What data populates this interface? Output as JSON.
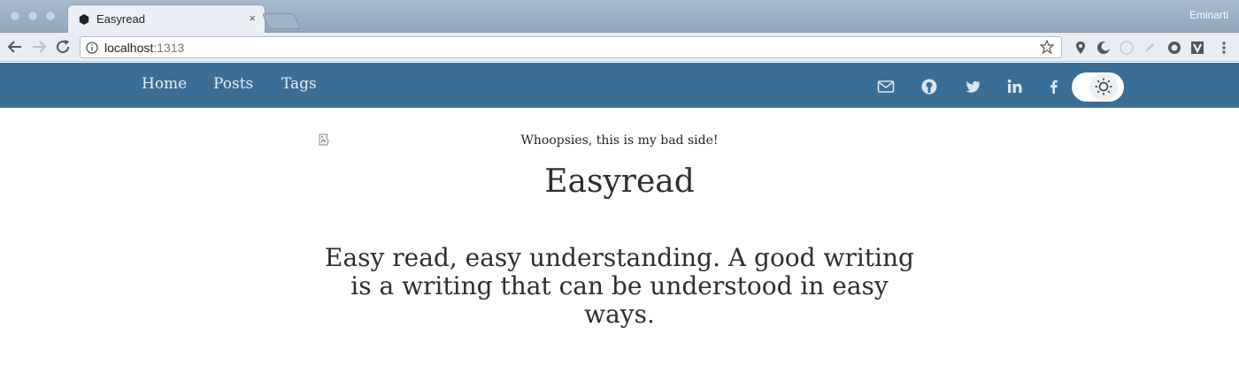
{
  "browser": {
    "tab": {
      "title": "Easyread",
      "close_glyph": "×",
      "favicon": "hexagon-icon"
    },
    "profile_name": "Eminarti",
    "url": {
      "host": "localhost",
      "port": ":1313"
    },
    "icons": [
      "back-arrow-icon",
      "forward-arrow-icon",
      "reload-icon",
      "info-icon",
      "star-icon"
    ]
  },
  "site": {
    "nav": {
      "home": "Home",
      "posts": "Posts",
      "tags": "Tags"
    },
    "social_icons": [
      "mail-icon",
      "github-icon",
      "twitter-icon",
      "linkedin-icon",
      "facebook-icon"
    ],
    "theme_toggle_icon": "sun-icon",
    "colors": {
      "navbar": "#3a6e96",
      "text": "#2a2f33"
    }
  },
  "hero": {
    "image_alt": "Whoopsies, this is my bad side!",
    "title": "Easyread",
    "tagline": "Easy read, easy understanding. A good writing is a writing that can be understood in easy ways."
  }
}
